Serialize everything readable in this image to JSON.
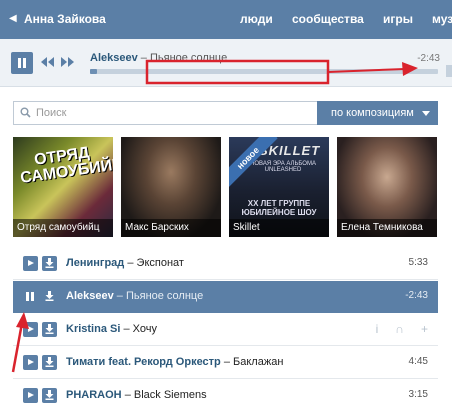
{
  "topbar": {
    "back_icon": "chevron-left-icon",
    "user_name": "Анна Зайкова",
    "nav": [
      "люди",
      "сообщества",
      "игры",
      "муз"
    ]
  },
  "player": {
    "artist": "Alekseev",
    "separator": "–",
    "title": "Пьяное солнце",
    "time": "-2:43",
    "progress_fraction": 0.02
  },
  "search": {
    "placeholder": "Поиск",
    "value": "",
    "scope_label": "по композициям"
  },
  "tiles": [
    {
      "caption": "Отряд самоубийц",
      "overlay": "ОТРЯД САМОУБИЙЦ"
    },
    {
      "caption": "Макс Барских"
    },
    {
      "caption": "Skillet",
      "ribbon": "новое",
      "logo": "SKILLET",
      "sub": "НОВАЯ ЭРА АЛЬБОМА UNLEASHED",
      "foot": "XX ЛЕТ ГРУППЕ ЮБИЛЕЙНОЕ ШОУ"
    },
    {
      "caption": "Елена Темникова"
    }
  ],
  "tracks": [
    {
      "artist": "Ленинград",
      "dash": "–",
      "song": "Экспонат",
      "duration": "5:33",
      "state": "default"
    },
    {
      "artist": "Alekseev",
      "dash": "–",
      "song": "Пьяное солнце",
      "duration": "-2:43",
      "state": "playing"
    },
    {
      "artist": "Kristina Si",
      "dash": "–",
      "song": "Хочу",
      "duration": "",
      "state": "hover"
    },
    {
      "artist": "Тимати feat. Рекорд Оркестр",
      "dash": "–",
      "song": "Баклажан",
      "duration": "4:45",
      "state": "default"
    },
    {
      "artist": "PHARAOH",
      "dash": "–",
      "song": "Black Siemens",
      "duration": "3:15",
      "state": "default"
    }
  ],
  "hover_actions": [
    "info-icon",
    "headphones-icon",
    "plus-icon"
  ],
  "colors": {
    "accent": "#5b7fa6",
    "link": "#2b587a",
    "annotation": "#d9232d"
  }
}
